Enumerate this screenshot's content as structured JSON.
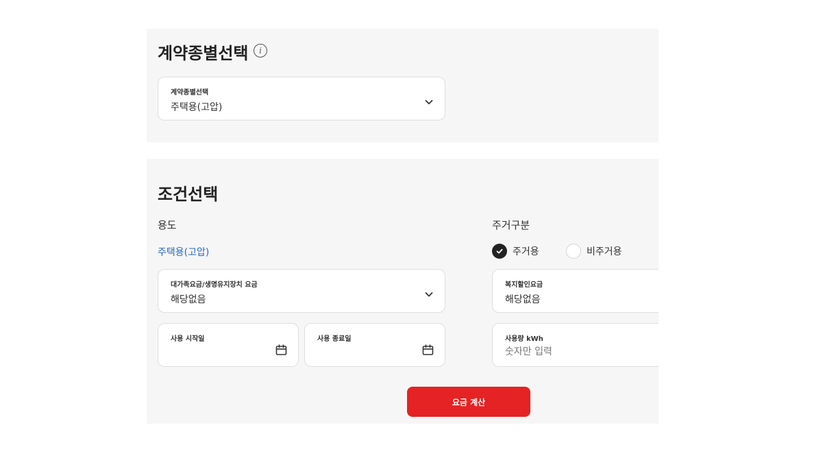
{
  "contract": {
    "title": "계약종별선택",
    "info_icon": "info-icon",
    "field_label": "계약종별선택",
    "field_value": "주택용(고압)"
  },
  "condition": {
    "title": "조건선택",
    "usage": {
      "label": "용도",
      "value": "주택용(고압)"
    },
    "residence": {
      "label": "주거구분",
      "options": [
        {
          "label": "주거용",
          "selected": true
        },
        {
          "label": "비주거용",
          "selected": false
        }
      ]
    },
    "large_family": {
      "label": "대가족요금/생명유지장치 요금",
      "value": "해당없음"
    },
    "welfare": {
      "label": "복지할인요금",
      "value": "해당없음"
    },
    "start_date": {
      "label": "사용 시작일",
      "icon": "calendar-icon"
    },
    "end_date": {
      "label": "사용 종료일",
      "icon": "calendar-icon"
    },
    "kwh": {
      "label": "사용량 kWh",
      "placeholder": "숫자만 입력"
    },
    "submit_label": "요금 계산"
  },
  "colors": {
    "panel_bg": "#f6f6f6",
    "accent_red": "#e52224",
    "link_blue": "#2a68c4"
  }
}
